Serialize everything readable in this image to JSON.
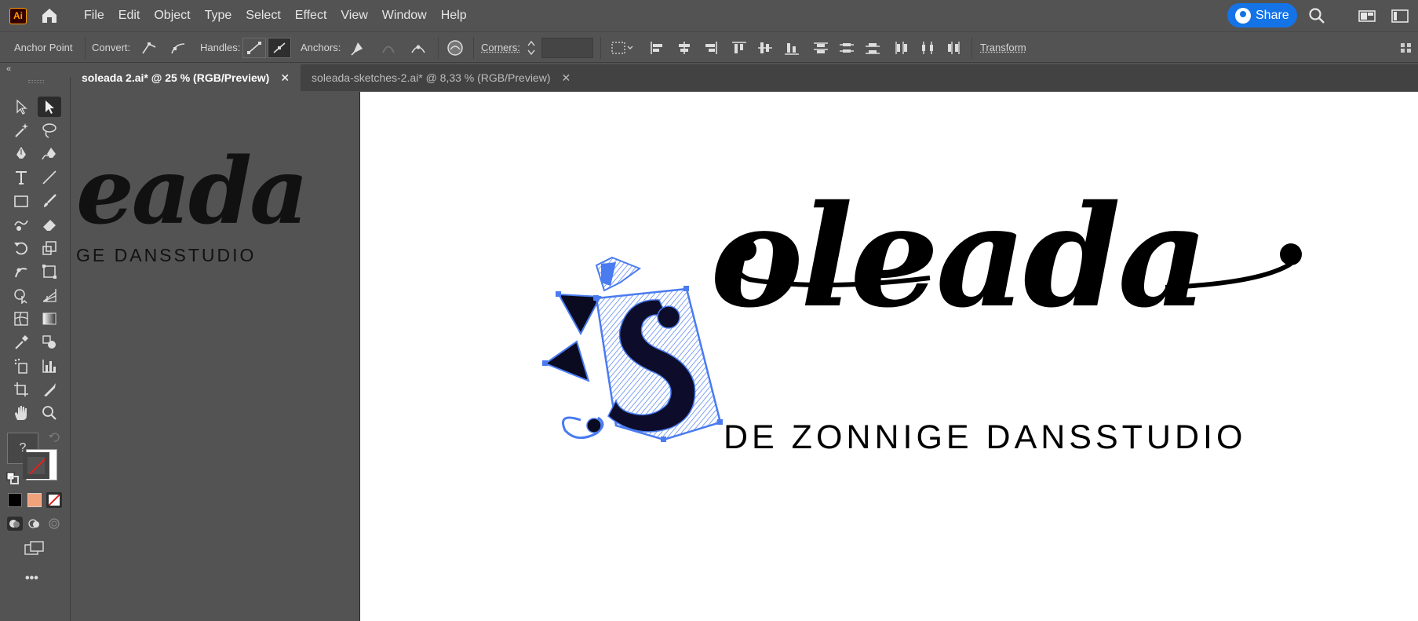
{
  "app": {
    "logo_text": "Ai"
  },
  "menu": [
    "File",
    "Edit",
    "Object",
    "Type",
    "Select",
    "Effect",
    "View",
    "Window",
    "Help"
  ],
  "share_label": "Share",
  "control_bar": {
    "tool_name": "Anchor Point",
    "convert_label": "Convert:",
    "handles_label": "Handles:",
    "anchors_label": "Anchors:",
    "corners_label": "Corners:",
    "corners_value": "",
    "transform_label": "Transform"
  },
  "tabs": [
    {
      "label": "soleada 2.ai* @ 25 % (RGB/Preview)",
      "active": true
    },
    {
      "label": "soleada-sketches-2.ai* @ 8,33 % (RGB/Preview)",
      "active": false
    }
  ],
  "toolbar": {
    "tools": [
      "selection-tool",
      "direct-selection-tool",
      "magic-wand-tool",
      "lasso-tool",
      "pen-tool",
      "curvature-tool",
      "type-tool",
      "line-segment-tool",
      "rectangle-tool",
      "paintbrush-tool",
      "shaper-tool",
      "eraser-tool",
      "rotate-tool",
      "scale-tool",
      "puppet-warp-tool",
      "free-transform-tool",
      "shape-builder-tool",
      "perspective-grid-tool",
      "mesh-tool",
      "gradient-tool",
      "eyedropper-tool",
      "blend-tool",
      "symbol-sprayer-tool",
      "column-graph-tool",
      "artboard-tool",
      "slice-tool",
      "hand-tool",
      "zoom-tool"
    ],
    "unknown_label": "?",
    "more_label": "•••"
  },
  "canvas": {
    "pasteboard_word": "eada",
    "pasteboard_tagline": "GE DANSSTUDIO",
    "logo_word": "oleada",
    "logo_tagline": "DE ZONNIGE DANSSTUDIO",
    "selection_color": "#4a7bf0"
  }
}
